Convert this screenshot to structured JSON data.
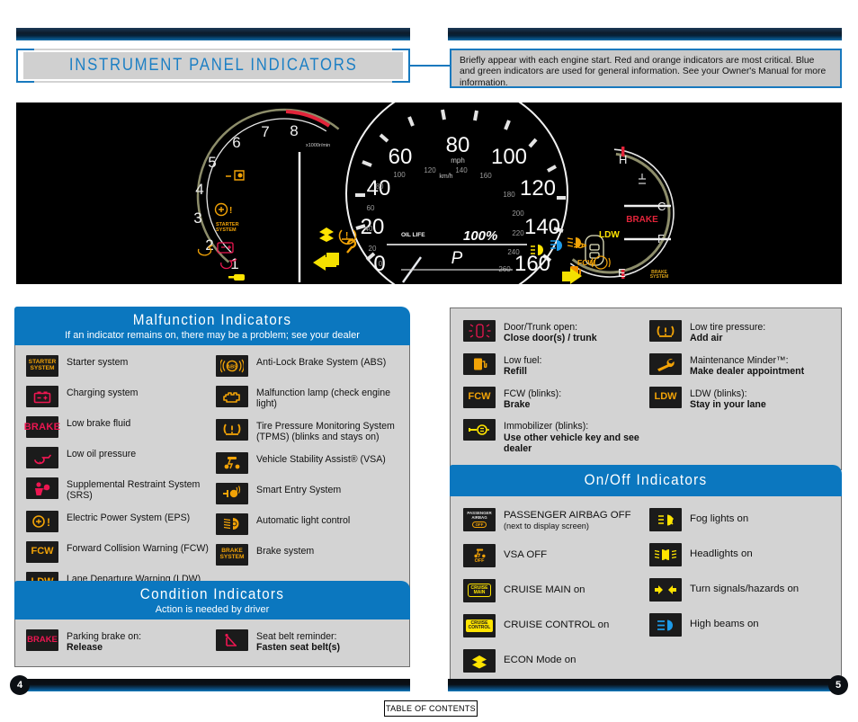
{
  "page": {
    "title": "INSTRUMENT PANEL INDICATORS",
    "intro": "Briefly appear with each engine start. Red and orange indicators are most critical. Blue and green indicators are used for general information. See your Owner's Manual for more information.",
    "left_page_number": "4",
    "right_page_number": "5",
    "toc_label": "TABLE OF CONTENTS",
    "accent_blue": "#0b77bf",
    "panel_gray": "#d3d3d3",
    "icon_black": "#1b1b1b"
  },
  "gauge": {
    "tach_label": "x1000r/min",
    "tach_numbers": [
      "1",
      "2",
      "3",
      "4",
      "5",
      "6",
      "7",
      "8"
    ],
    "speed_unit_mph": "mph",
    "speed_unit_kmh": "km/h",
    "mph_numbers": [
      "0",
      "20",
      "40",
      "60",
      "80",
      "100",
      "120",
      "140",
      "160"
    ],
    "kmh_numbers": [
      "0",
      "20",
      "40",
      "60",
      "80",
      "100",
      "120",
      "140",
      "160",
      "180",
      "200",
      "220",
      "240",
      "260"
    ],
    "oil_life_label": "OIL LIFE",
    "oil_life_value": "100%",
    "gear": "P",
    "temp_high": "H",
    "temp_low": "C",
    "fuel_full": "F",
    "fuel_empty": "E",
    "text_indicators": [
      "LDW",
      "FCW",
      "BRAKE",
      "BRAKE SYSTEM",
      "CRUISE MAIN",
      "CRUISE CONTROL",
      "STARTER SYSTEM"
    ]
  },
  "malfunction": {
    "title": "Malfunction Indicators",
    "subtitle": "If an indicator remains on, there may be a problem; see your dealer",
    "left": [
      {
        "icon": "starter-system-icon",
        "label": "Starter system"
      },
      {
        "icon": "charging-system-icon",
        "label": "Charging system"
      },
      {
        "icon": "brake-icon",
        "label": "Low brake fluid"
      },
      {
        "icon": "oil-pressure-icon",
        "label": "Low oil pressure"
      },
      {
        "icon": "srs-airbag-icon",
        "label": "Supplemental Restraint System (SRS)"
      },
      {
        "icon": "eps-icon",
        "label": "Electric Power System (EPS)"
      },
      {
        "icon": "fcw-icon",
        "label": "Forward Collision Warning (FCW)"
      },
      {
        "icon": "ldw-icon",
        "label": "Lane Departure Warning (LDW)"
      }
    ],
    "right": [
      {
        "icon": "abs-icon",
        "label": "Anti-Lock Brake System (ABS)"
      },
      {
        "icon": "check-engine-icon",
        "label": "Malfunction lamp (check engine light)"
      },
      {
        "icon": "tpms-icon",
        "label": "Tire Pressure Monitoring System (TPMS) (blinks and stays on)"
      },
      {
        "icon": "vsa-icon",
        "label": "Vehicle Stability Assist® (VSA)"
      },
      {
        "icon": "smart-entry-icon",
        "label": "Smart Entry System"
      },
      {
        "icon": "auto-light-icon",
        "label": "Automatic light control"
      },
      {
        "icon": "brake-system-icon",
        "label": "Brake system"
      }
    ]
  },
  "condition": {
    "title": "Condition Indicators",
    "subtitle": "Action is needed by driver",
    "left": [
      {
        "icon": "brake-icon",
        "label": "Parking brake on:",
        "action": "Release"
      }
    ],
    "right": [
      {
        "icon": "seatbelt-icon",
        "label": "Seat belt reminder:",
        "action": "Fasten seat belt(s)"
      }
    ]
  },
  "action_panel": {
    "left": [
      {
        "icon": "door-open-icon",
        "label": "Door/Trunk open:",
        "action": "Close door(s) / trunk"
      },
      {
        "icon": "low-fuel-icon",
        "label": "Low fuel:",
        "action": "Refill"
      },
      {
        "icon": "fcw-icon",
        "label": "FCW (blinks):",
        "action": "Brake"
      },
      {
        "icon": "immobilizer-icon",
        "label": "Immobilizer (blinks):",
        "action": "Use other vehicle key and see dealer"
      }
    ],
    "right": [
      {
        "icon": "tpms-icon",
        "label": "Low tire pressure:",
        "action": "Add air"
      },
      {
        "icon": "wrench-icon",
        "label": "Maintenance Minder™:",
        "action": "Make dealer appointment"
      },
      {
        "icon": "ldw-icon",
        "label": "LDW (blinks):",
        "action": "Stay in your lane"
      }
    ]
  },
  "onoff": {
    "title": "On/Off Indicators",
    "left": [
      {
        "icon": "passenger-airbag-off-icon",
        "label": "PASSENGER AIRBAG OFF",
        "sub": "(next to display screen)"
      },
      {
        "icon": "vsa-off-icon",
        "label": "VSA OFF"
      },
      {
        "icon": "cruise-main-icon",
        "label": "CRUISE MAIN on"
      },
      {
        "icon": "cruise-control-icon",
        "label": "CRUISE CONTROL on"
      },
      {
        "icon": "econ-icon",
        "label": "ECON Mode on"
      }
    ],
    "right": [
      {
        "icon": "fog-lights-icon",
        "label": "Fog lights on"
      },
      {
        "icon": "headlights-icon",
        "label": "Headlights on"
      },
      {
        "icon": "turn-signal-icon",
        "label": "Turn signals/hazards on"
      },
      {
        "icon": "high-beam-icon",
        "label": "High beams on"
      }
    ]
  }
}
